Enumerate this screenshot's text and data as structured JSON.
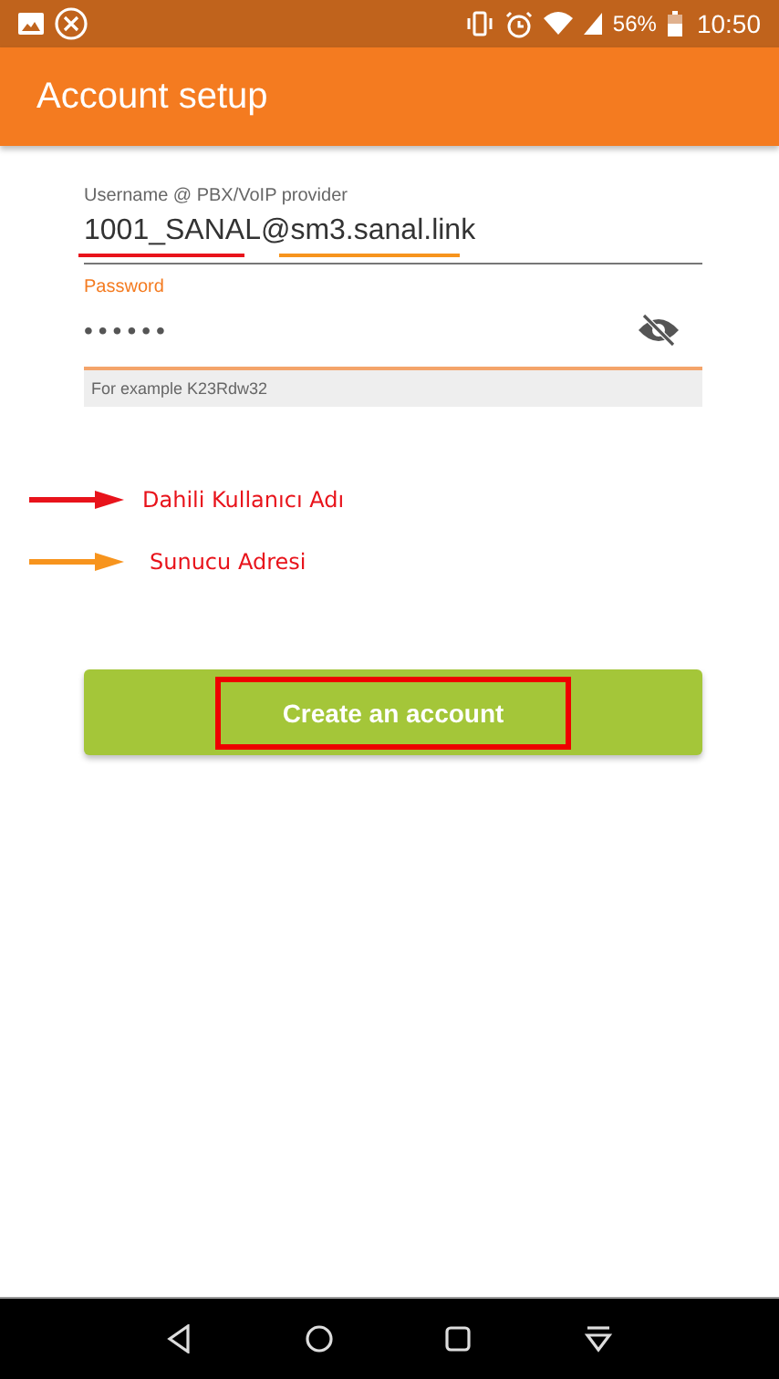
{
  "status_bar": {
    "battery": "56%",
    "time": "10:50"
  },
  "app_bar": {
    "title": "Account setup"
  },
  "username": {
    "label": "Username @ PBX/VoIP provider",
    "value": "1001_SANAL@sm3.sanal.link"
  },
  "password": {
    "label": "Password",
    "value": "••••••",
    "focused": true,
    "hint": "For example K23Rdw32"
  },
  "annotations": [
    {
      "text": "Dahili Kullanıcı Adı",
      "color": "#e8131b"
    },
    {
      "text": "Sunucu Adresi",
      "color": "#f7941d"
    }
  ],
  "create_button": {
    "label": "Create an account",
    "highlighted": true
  }
}
